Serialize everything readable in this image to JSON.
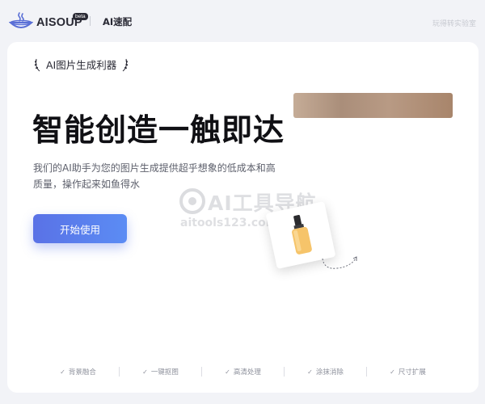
{
  "header": {
    "logo_text": "AISOUP",
    "beta_label": "beta",
    "nav_title": "AI速配",
    "lab_link": "玩得转实验室"
  },
  "hero": {
    "tagline": "AI图片生成利器",
    "headline": "智能创造一触即达",
    "description": "我们的AI助手为您的图片生成提供超乎想象的低成本和高质量，操作起来如鱼得水",
    "start_button": "开始使用"
  },
  "watermark": {
    "title": "AI工具导航",
    "url": "aitools123.com"
  },
  "features": [
    {
      "label": "背景融合"
    },
    {
      "label": "一键抠图"
    },
    {
      "label": "高清处理"
    },
    {
      "label": "涂抹消除"
    },
    {
      "label": "尺寸扩展"
    }
  ],
  "colors": {
    "accent": "#5b7ef0",
    "background": "#f2f3f7",
    "card": "#ffffff"
  }
}
